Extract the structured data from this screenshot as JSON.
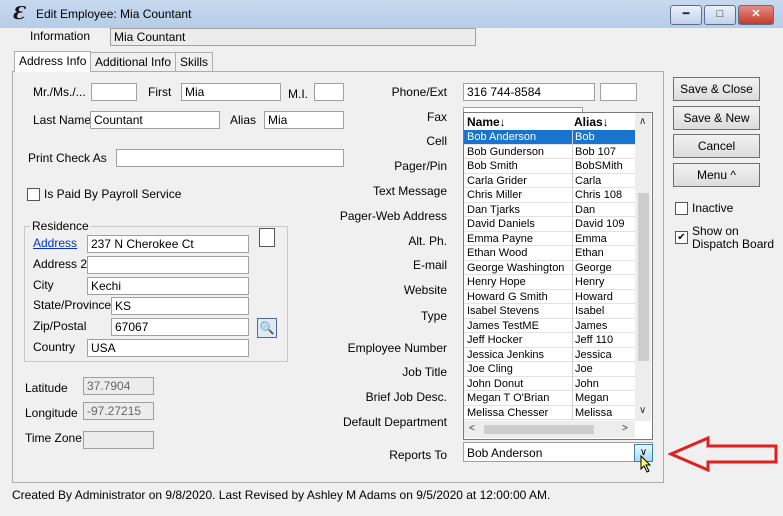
{
  "window": {
    "title": "Edit Employee: Mia Countant",
    "app_icon_glyph": "Ɛ"
  },
  "info": {
    "label": "Information",
    "value": "Mia Countant"
  },
  "tabs": [
    {
      "label": "Address Info",
      "active": true
    },
    {
      "label": "Additional Info",
      "active": false
    },
    {
      "label": "Skills",
      "active": false
    }
  ],
  "name": {
    "prefix_label": "Mr./Ms./...",
    "first_label": "First",
    "first_value": "Mia",
    "mi_label": "M.I.",
    "last_label": "Last Name",
    "last_value": "Countant",
    "alias_label": "Alias",
    "alias_value": "Mia",
    "print_check_label": "Print Check As",
    "payroll_label": "Is Paid By Payroll Service"
  },
  "residence": {
    "group_label": "Residence",
    "address_label": "Address",
    "address_value": "237 N Cherokee Ct",
    "address2_label": "Address 2",
    "city_label": "City",
    "city_value": "Kechi",
    "state_label": "State/Province",
    "state_value": "KS",
    "zip_label": "Zip/Postal",
    "zip_value": "67067",
    "country_label": "Country",
    "country_value": "USA"
  },
  "geo": {
    "lat_label": "Latitude",
    "lat_value": "37.7904",
    "lon_label": "Longitude",
    "lon_value": "-97.27215",
    "tz_label": "Time Zone"
  },
  "contact_labels": {
    "phone": "Phone/Ext",
    "fax": "Fax",
    "cell": "Cell",
    "pager": "Pager/Pin",
    "text_message": "Text Message",
    "pager_web": "Pager-Web Address",
    "alt_ph": "Alt. Ph.",
    "email": "E-mail",
    "website": "Website",
    "type": "Type",
    "employee_number": "Employee Number",
    "job_title": "Job Title",
    "brief_job": "Brief Job Desc.",
    "default_dept": "Default Department",
    "reports_to": "Reports To"
  },
  "phone_value": "316 744-8584",
  "reports_to_value": "Bob Anderson",
  "dropdown": {
    "col_name": "Name↓",
    "col_alias": "Alias↓",
    "rows": [
      {
        "name": "Bob Anderson",
        "alias": "Bob",
        "selected": true
      },
      {
        "name": "Bob Gunderson",
        "alias": "Bob 107"
      },
      {
        "name": "Bob Smith",
        "alias": "BobSMith"
      },
      {
        "name": "Carla Grider",
        "alias": "Carla"
      },
      {
        "name": "Chris Miller",
        "alias": "Chris 108"
      },
      {
        "name": "Dan Tjarks",
        "alias": "Dan"
      },
      {
        "name": "David Daniels",
        "alias": "David 109"
      },
      {
        "name": "Emma Payne",
        "alias": "Emma"
      },
      {
        "name": "Ethan Wood",
        "alias": "Ethan"
      },
      {
        "name": "George Washington",
        "alias": "George"
      },
      {
        "name": "Henry Hope",
        "alias": "Henry"
      },
      {
        "name": "Howard G Smith",
        "alias": "Howard"
      },
      {
        "name": "Isabel Stevens",
        "alias": "Isabel"
      },
      {
        "name": "James TestME",
        "alias": "James"
      },
      {
        "name": "Jeff Hocker",
        "alias": "Jeff 110"
      },
      {
        "name": "Jessica Jenkins",
        "alias": "Jessica"
      },
      {
        "name": "Joe Cling",
        "alias": "Joe"
      },
      {
        "name": "John Donut",
        "alias": "John"
      },
      {
        "name": "Megan T O'Brian",
        "alias": "Megan"
      },
      {
        "name": "Melissa Chesser",
        "alias": "Melissa"
      }
    ]
  },
  "buttons": {
    "save_close": "Save & Close",
    "save_new": "Save & New",
    "cancel": "Cancel",
    "menu": "Menu ^"
  },
  "options": {
    "inactive_label": "Inactive",
    "inactive_checked": false,
    "dispatch_label": "Show on Dispatch Board",
    "dispatch_checked": true
  },
  "status_text": "Created By Administrator on 9/8/2020.  Last Revised by Ashley M Adams on 9/5/2020 at 12:00:00 AM.",
  "colors": {
    "selection": "#1874cd",
    "annotation_arrow": "#e02020",
    "titlebar": "#c7d9ef"
  }
}
